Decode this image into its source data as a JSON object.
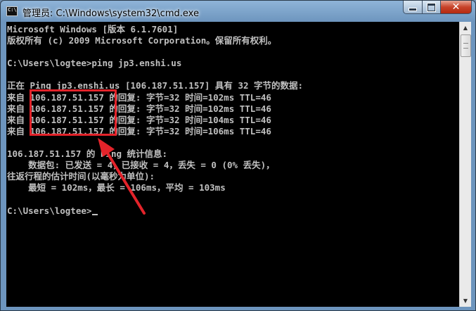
{
  "window": {
    "title": "管理员: C:\\Windows\\system32\\cmd.exe",
    "icon": "cmd-icon",
    "close_glyph": "✕"
  },
  "console": {
    "lines": [
      "Microsoft Windows [版本 6.1.7601]",
      "版权所有 (c) 2009 Microsoft Corporation。保留所有权利。",
      "",
      "C:\\Users\\logtee>ping jp3.enshi.us",
      "",
      "正在 Ping jp3.enshi.us [106.187.51.157] 具有 32 字节的数据:",
      "来自 106.187.51.157 的回复: 字节=32 时间=102ms TTL=46",
      "来自 106.187.51.157 的回复: 字节=32 时间=102ms TTL=46",
      "来自 106.187.51.157 的回复: 字节=32 时间=104ms TTL=46",
      "来自 106.187.51.157 的回复: 字节=32 时间=106ms TTL=46",
      "",
      "106.187.51.157 的 Ping 统计信息:",
      "    数据包: 已发送 = 4，已接收 = 4，丢失 = 0 (0% 丢失)，",
      "往返行程的估计时间(以毫秒为单位):",
      "    最短 = 102ms，最长 = 106ms，平均 = 103ms",
      "",
      "C:\\Users\\logtee>"
    ]
  },
  "colors": {
    "console_bg": "#000000",
    "console_text": "#c0c0c0",
    "annotation_red": "#e3232a"
  }
}
